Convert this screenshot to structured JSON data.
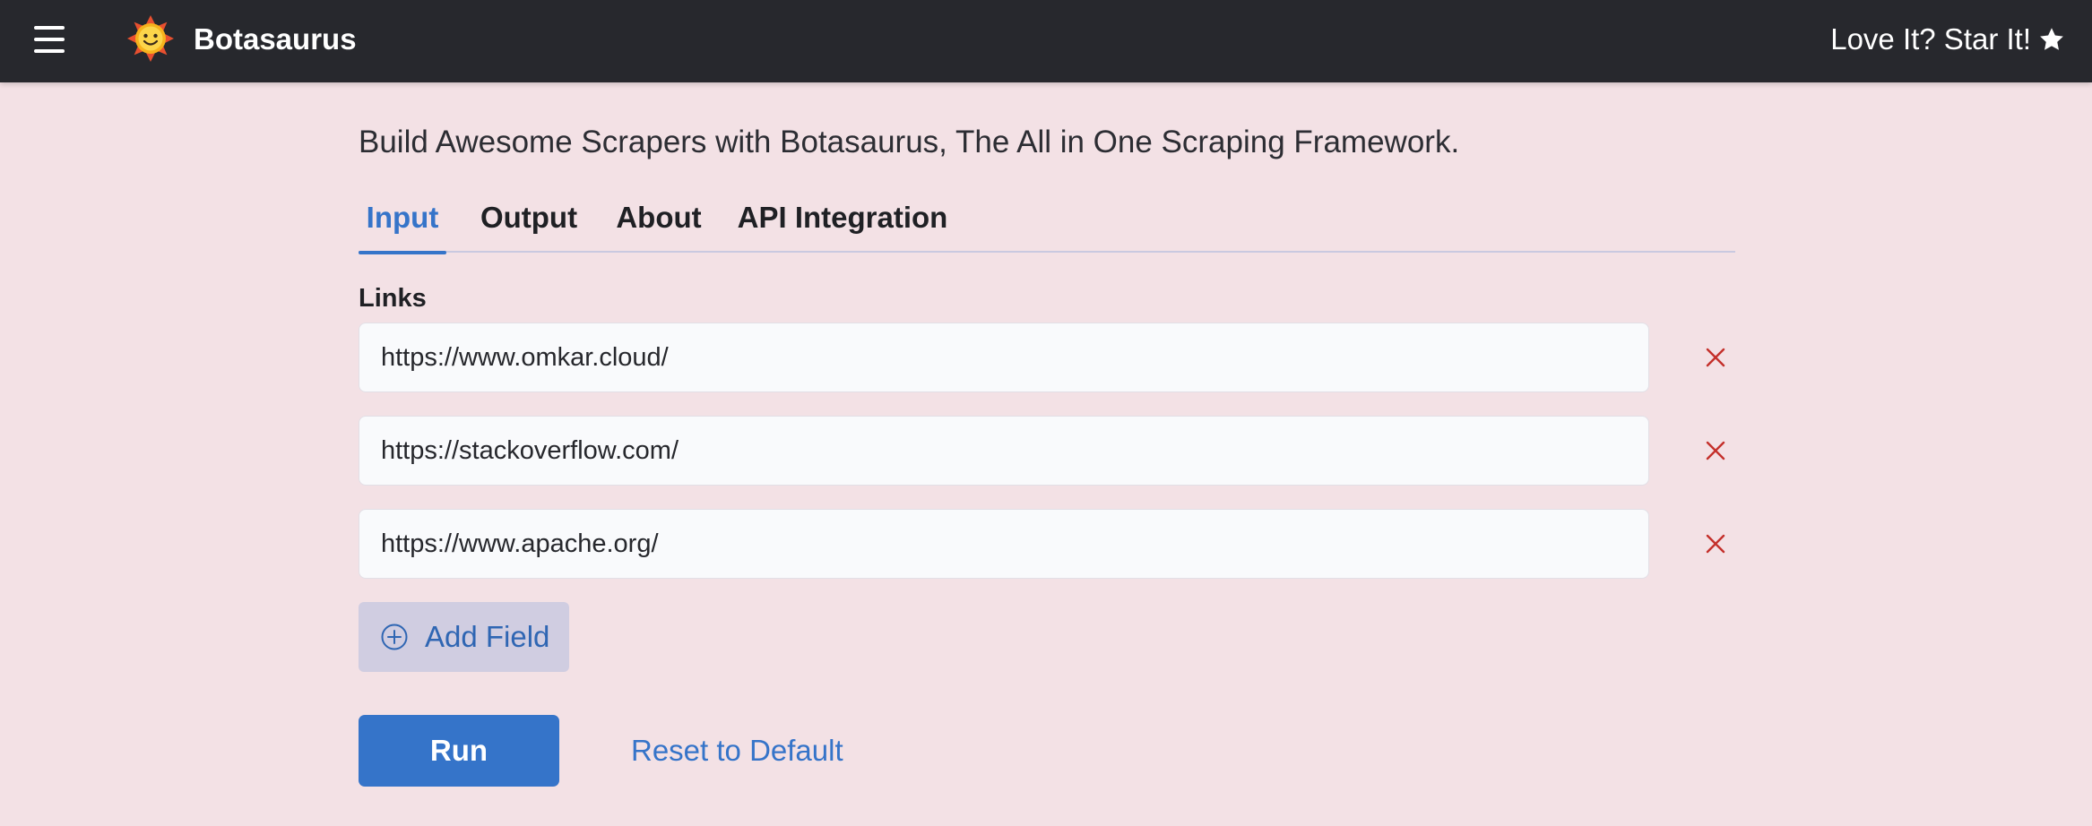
{
  "header": {
    "brand": "Botasaurus",
    "star_cta": "Love It? Star It!",
    "icons": {
      "menu": "hamburger-menu-icon",
      "logo": "sun-logo-icon",
      "star": "star-icon"
    }
  },
  "tagline": "Build Awesome Scrapers with Botasaurus, The All in One Scraping Framework.",
  "tabs": [
    {
      "label": "Input",
      "active": true
    },
    {
      "label": "Output",
      "active": false
    },
    {
      "label": "About",
      "active": false
    },
    {
      "label": "API Integration",
      "active": false
    }
  ],
  "form": {
    "links_label": "Links",
    "links": [
      {
        "value": "https://www.omkar.cloud/"
      },
      {
        "value": "https://stackoverflow.com/"
      },
      {
        "value": "https://www.apache.org/"
      }
    ],
    "add_field_label": "Add Field",
    "run_label": "Run",
    "reset_label": "Reset to Default"
  },
  "colors": {
    "header_bg": "#27282d",
    "page_bg": "#f3e1e5",
    "accent": "#3574c9",
    "remove_icon": "#c4302b",
    "add_field_bg": "#d0cde1"
  }
}
